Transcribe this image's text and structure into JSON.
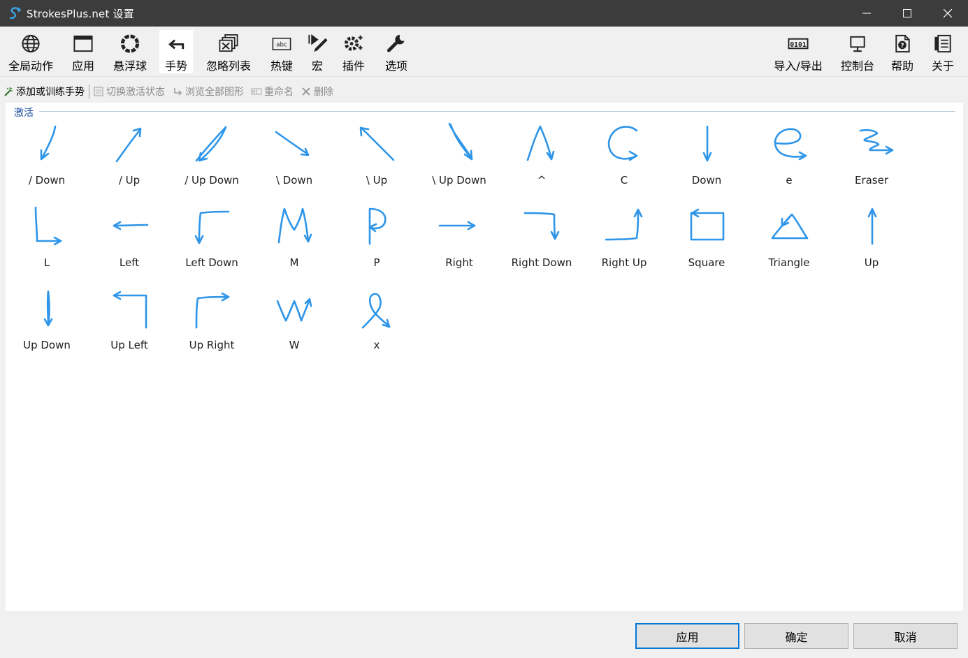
{
  "window": {
    "title": "StrokesPlus.net 设置"
  },
  "toolbar": {
    "left": [
      {
        "name": "global-actions",
        "label": "全局动作",
        "icon": "globe-icon"
      },
      {
        "name": "applications",
        "label": "应用",
        "icon": "window-icon"
      },
      {
        "name": "floating-ball",
        "label": "悬浮球",
        "icon": "ring-icon"
      },
      {
        "name": "gestures",
        "label": "手势",
        "icon": "gesture-arrow-icon",
        "active": true
      },
      {
        "name": "ignore-list",
        "label": "忽略列表",
        "icon": "ignore-list-icon"
      },
      {
        "name": "hotkeys",
        "label": "热键",
        "icon": "keyboard-icon"
      },
      {
        "name": "macros",
        "label": "宏",
        "icon": "macro-icon"
      },
      {
        "name": "plugins",
        "label": "插件",
        "icon": "plugin-gear-icon"
      },
      {
        "name": "options",
        "label": "选项",
        "icon": "wrench-icon"
      }
    ],
    "right": [
      {
        "name": "import-export",
        "label": "导入/导出",
        "icon": "binary-icon"
      },
      {
        "name": "console",
        "label": "控制台",
        "icon": "monitor-icon"
      },
      {
        "name": "help",
        "label": "帮助",
        "icon": "help-doc-icon"
      },
      {
        "name": "about",
        "label": "关于",
        "icon": "about-doc-icon"
      }
    ]
  },
  "subtoolbar": {
    "add_train": "添加或训练手势",
    "toggle_active": "切换激活状态",
    "browse_all": "浏览全部图形",
    "rename": "重命名",
    "delete": "删除"
  },
  "group": {
    "label": "激活"
  },
  "gestures": [
    {
      "label": "/ Down"
    },
    {
      "label": "/ Up"
    },
    {
      "label": "/ Up Down"
    },
    {
      "label": "\\ Down"
    },
    {
      "label": "\\ Up"
    },
    {
      "label": "\\ Up Down"
    },
    {
      "label": "^"
    },
    {
      "label": "C"
    },
    {
      "label": "Down"
    },
    {
      "label": "e"
    },
    {
      "label": "Eraser"
    },
    {
      "label": "L"
    },
    {
      "label": "Left"
    },
    {
      "label": "Left Down"
    },
    {
      "label": "M"
    },
    {
      "label": "P"
    },
    {
      "label": "Right"
    },
    {
      "label": "Right Down"
    },
    {
      "label": "Right Up"
    },
    {
      "label": "Square"
    },
    {
      "label": "Triangle"
    },
    {
      "label": "Up"
    },
    {
      "label": "Up Down"
    },
    {
      "label": "Up Left"
    },
    {
      "label": "Up Right"
    },
    {
      "label": "W"
    },
    {
      "label": "x"
    }
  ],
  "buttons": {
    "apply": "应用",
    "ok": "确定",
    "cancel": "取消"
  },
  "colors": {
    "stroke": "#2e95e8",
    "titlebar": "#3c3c3c",
    "group_label": "#1e4fa0"
  }
}
